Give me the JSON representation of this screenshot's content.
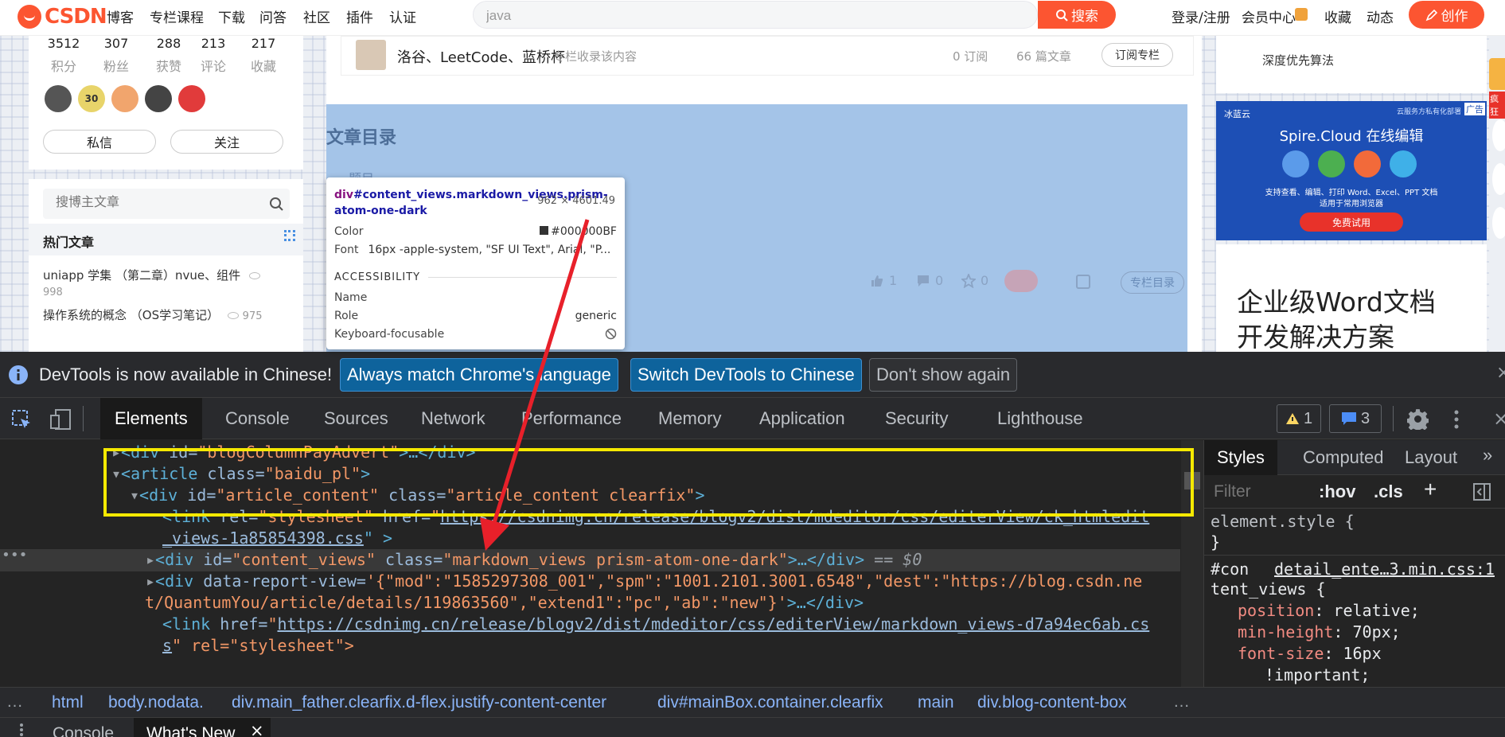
{
  "topbar": {
    "logo_text": "CSDN",
    "nav": [
      "博客",
      "专栏课程",
      "下载",
      "问答",
      "社区",
      "插件",
      "认证"
    ],
    "search_value": "java",
    "search_button": "搜索",
    "right_nav": [
      "登录/注册",
      "会员中心",
      "收藏",
      "动态"
    ],
    "create_button": "创作"
  },
  "profile": {
    "stats": [
      {
        "num": "3512",
        "label": "积分"
      },
      {
        "num": "307",
        "label": "粉丝"
      },
      {
        "num": "288",
        "label": "获赞"
      },
      {
        "num": "213",
        "label": "评论"
      },
      {
        "num": "217",
        "label": "收藏"
      }
    ],
    "badge_30": "30",
    "message_button": "私信",
    "follow_button": "关注",
    "search_placeholder": "搜博主文章",
    "hot_title": "热门文章",
    "hot_articles": [
      {
        "title": "uniapp 学集 （第二章）nvue、组件",
        "views": "998"
      },
      {
        "title": "操作系统的概念 （OS学习笔记）",
        "views": "975"
      }
    ]
  },
  "column": {
    "name": "洛谷、LeetCode、蓝桥杯",
    "note": "专栏收录该内容",
    "subs": "0 订阅",
    "articles": "66 篇文章",
    "subscribe_button": "订阅专栏"
  },
  "toc": {
    "title": "文章目录",
    "first_item": "题目"
  },
  "article_actions": {
    "likes": "1",
    "comments": "0",
    "stars": "0",
    "column_toc_button": "专栏目录"
  },
  "tooltip": {
    "selector_tag": "div",
    "selector_rest": "#content_views.markdown_views.prism-atom-one-dark",
    "dimensions": "962 × 4601.49",
    "color_label": "Color",
    "color_value": "#000000BF",
    "font_label": "Font",
    "font_value": "16px -apple-system, \"SF UI Text\", Arial, \"P...",
    "accessibility_header": "ACCESSIBILITY",
    "name_label": "Name",
    "role_label": "Role",
    "role_value": "generic",
    "kf_label": "Keyboard-focusable"
  },
  "right_sidebar": {
    "top_item": "深度优先算法",
    "ad_brand": "冰蓝云",
    "ad_title": "Spire.Cloud 在线编辑",
    "ad_tag": "广告",
    "ad_top_right": "云服务方私有化部署",
    "ad_desc_1": "支持查看、编辑、打印 Word、Excel、PPT 文档",
    "ad_desc_2": "适用于常用浏览器",
    "ad_button": "免费试用",
    "promo_1": "企业级Word文档",
    "promo_2": "开发解决方案",
    "edge_tag": "疯狂"
  },
  "devtools": {
    "info_text": "DevTools is now available in Chinese!",
    "btn_match": "Always match Chrome's language",
    "btn_switch": "Switch DevTools to Chinese",
    "btn_dismiss": "Don't show again",
    "tabs": [
      "Elements",
      "Console",
      "Sources",
      "Network",
      "Performance",
      "Memory",
      "Application",
      "Security",
      "Lighthouse"
    ],
    "warnings": "1",
    "messages": "3",
    "dom": {
      "l1_open": "<div ",
      "l1_attr": "id=",
      "l1_val": "\"blogColumnPayAdvert\"",
      "l1_close": ">…</div>",
      "l2_open": "<article ",
      "l2_attr": "class=",
      "l2_val": "\"baidu_pl\"",
      "l2_close": ">",
      "l3_open": "<div ",
      "l3_attr1": "id=",
      "l3_val1": "\"article_content\"",
      "l3_attr2": " class=",
      "l3_val2": "\"article_content clearfix\"",
      "l3_close": ">",
      "l4_open": "<link ",
      "l4_attr1": "rel=",
      "l4_val1": "\"stylesheet\"",
      "l4_attr2": " href=",
      "l4_q": "\"",
      "l4_url": "https://csdnimg.cn/release/blogv2/dist/mdeditor/css/editerView/ck_htmledit",
      "l4b_url": "_views-1a85854398.css",
      "l4b_end": "\" >",
      "l5_open": "<div ",
      "l5_attr1": "id=",
      "l5_val1": "\"content_views\"",
      "l5_attr2": " class=",
      "l5_val2": "\"markdown_views prism-atom-one-dark\"",
      "l5_close": ">…</div>",
      "l5_eq": " == $0",
      "l6_open": "<div ",
      "l6_attr": "data-report-view=",
      "l6_val": "'{\"mod\":\"1585297308_001\",\"spm\":\"1001.2101.3001.6548\",\"dest\":\"https://blog.csdn.ne",
      "l6b_val": "t/QuantumYou/article/details/119863560\",\"extend1\":\"pc\",\"ab\":\"new\"}'",
      "l6b_close": ">…</div>",
      "l7_open": "<link ",
      "l7_attr": "href=",
      "l7_q": "\"",
      "l7_url": "https://csdnimg.cn/release/blogv2/dist/mdeditor/css/editerView/markdown_views-d7a94ec6ab.cs",
      "l7b_url": "s",
      "l7b_rest": "\" rel=\"stylesheet\">"
    },
    "styles_tabs": [
      "Styles",
      "Computed",
      "Layout"
    ],
    "filter_placeholder": "Filter",
    "hov": ":hov",
    "cls": ".cls",
    "element_style": "element.style {",
    "close_brace": "}",
    "rule_selector_1": "#con",
    "rule_source": "detail_ente…3.min.css:1",
    "rule_selector_2": "tent_views {",
    "props": [
      {
        "name": "position",
        "value": "relative;"
      },
      {
        "name": "min-height",
        "value": "70px;"
      },
      {
        "name": "font-size",
        "value": "16px"
      }
    ],
    "important": "!important;",
    "breadcrumbs": [
      "html",
      "body.nodata.",
      "div.main_father.clearfix.d-flex.justify-content-center",
      "div#mainBox.container.clearfix",
      "main",
      "div.blog-content-box"
    ],
    "drawer_tabs": [
      "Console",
      "What's New"
    ]
  },
  "colors": {
    "accent": "#fc5531",
    "highlight": "#f5e900",
    "arrow": "#e8202a"
  }
}
